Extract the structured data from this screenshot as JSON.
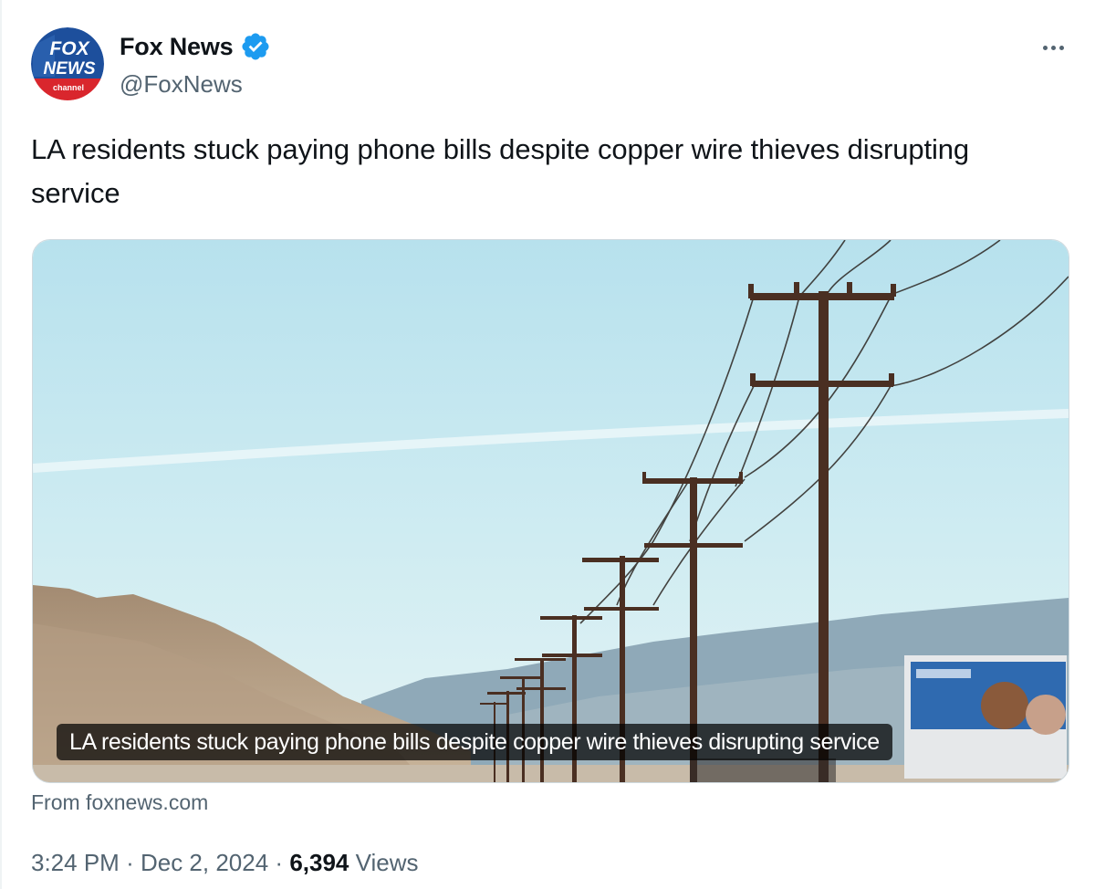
{
  "author": {
    "display_name": "Fox News",
    "handle": "@FoxNews",
    "verified": true,
    "avatar_logo_lines": [
      "FOX",
      "NEWS",
      "channel"
    ]
  },
  "tweet": {
    "text": "LA residents stuck paying phone bills despite copper wire thieves disrupting service",
    "media_caption": "LA residents stuck paying phone bills despite copper wire thieves disrupting service",
    "source": "From foxnews.com"
  },
  "meta": {
    "time": "3:24 PM",
    "separator": "·",
    "date": "Dec 2, 2024",
    "views_count": "6,394",
    "views_label": "Views"
  },
  "icons": {
    "avatar": "fox-news-logo",
    "verified": "verified-badge-icon",
    "more": "more-options-icon"
  },
  "colors": {
    "verified_blue": "#1d9bf0",
    "secondary_text": "#536471",
    "primary_text": "#0f1419"
  }
}
